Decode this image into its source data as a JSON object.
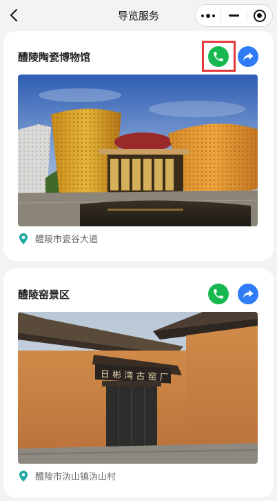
{
  "navbar": {
    "title": "导览服务",
    "back_icon": "chevron-left-icon",
    "capsule": {
      "more_icon": "more-dots-icon",
      "minimize_icon": "minus-icon",
      "close_icon": "target-circle-icon"
    }
  },
  "places": [
    {
      "name": "醴陵陶瓷博物馆",
      "address": "醴陵市瓷谷大道",
      "phone_icon": "phone-icon",
      "share_icon": "navigate-share-icon",
      "highlighted": "phone-button",
      "photo": "museum-photo"
    },
    {
      "name": "醴陵窑景区",
      "address": "醴陵市沩山镇沩山村",
      "phone_icon": "phone-icon",
      "share_icon": "navigate-share-icon",
      "photo": "kiln-gate-photo"
    }
  ],
  "colors": {
    "phone_button": "#16b84f",
    "share_button": "#2f7cf6",
    "pin": "#1fa9a4",
    "highlight_box": "#e5393a",
    "background": "#f2f3f5"
  }
}
